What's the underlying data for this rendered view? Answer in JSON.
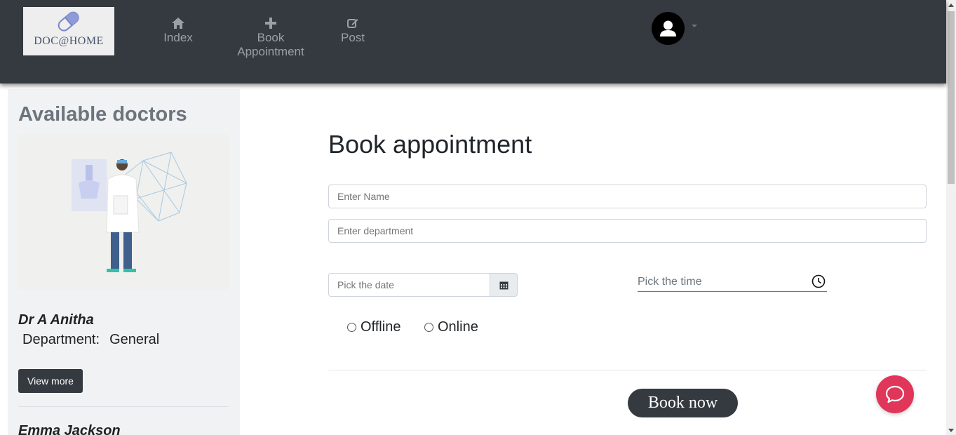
{
  "brand": {
    "logo_text": "DOC@HOME"
  },
  "nav": {
    "items": [
      {
        "label": "Index",
        "icon": "home-icon"
      },
      {
        "label": "Book\nAppointment",
        "icon": "plus-icon"
      },
      {
        "label": "Post",
        "icon": "edit-icon"
      }
    ],
    "avatar_icon": "user-avatar-icon"
  },
  "sidebar": {
    "title": "Available doctors",
    "doctors": [
      {
        "name": "Dr A Anitha",
        "department_label": "Department:",
        "department": "General",
        "button": "View more"
      },
      {
        "name": "Emma Jackson"
      }
    ]
  },
  "form": {
    "title": "Book appointment",
    "name_placeholder": "Enter Name",
    "department_placeholder": "Enter department",
    "date_placeholder": "Pick the date",
    "time_placeholder": "Pick the time",
    "mode_options": [
      "Offline",
      "Online"
    ],
    "submit_label": "Book now"
  },
  "colors": {
    "navbar": "#343a40",
    "sidebar_bg": "#f1f2f4",
    "chat_fab": "#e0365a",
    "button_dark": "#343a40"
  }
}
